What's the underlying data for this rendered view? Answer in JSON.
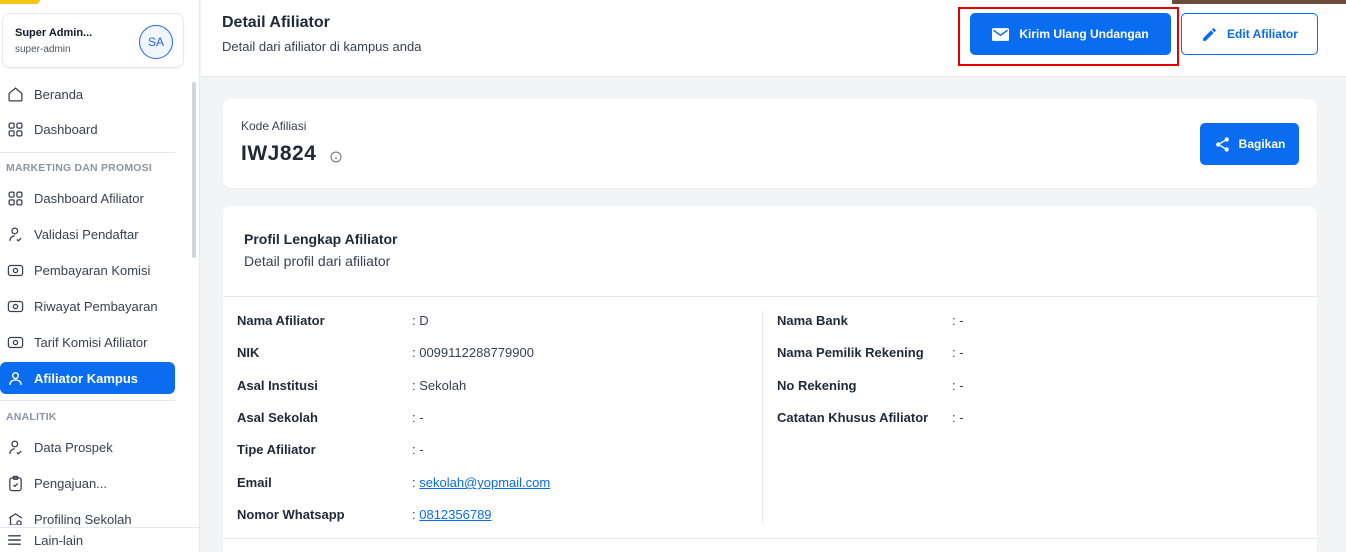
{
  "user": {
    "name": "Super Admin...",
    "role": "super-admin",
    "initials": "SA"
  },
  "sidebar": {
    "items": [
      {
        "label": "Beranda",
        "icon": "home-icon"
      },
      {
        "label": "Dashboard",
        "icon": "grid-icon"
      }
    ],
    "sections": [
      {
        "title": "MARKETING DAN PROMOSI",
        "items": [
          {
            "label": "Dashboard Afiliator",
            "icon": "grid-icon"
          },
          {
            "label": "Validasi Pendaftar",
            "icon": "user-check-icon"
          },
          {
            "label": "Pembayaran Komisi",
            "icon": "money-icon"
          },
          {
            "label": "Riwayat Pembayaran",
            "icon": "money-icon"
          },
          {
            "label": "Tarif Komisi Afiliator",
            "icon": "money-icon"
          },
          {
            "label": "Afiliator Kampus",
            "icon": "user-icon",
            "active": true
          }
        ]
      },
      {
        "title": "ANALITIK",
        "items": [
          {
            "label": "Data Prospek",
            "icon": "user-check-icon"
          },
          {
            "label": "Pengajuan...",
            "icon": "clipboard-check-icon"
          },
          {
            "label": "Profiling Sekolah",
            "icon": "school-search-icon"
          }
        ]
      }
    ],
    "bottom": {
      "label": "Lain-lain",
      "icon": "menu-icon"
    }
  },
  "header": {
    "title": "Detail Afiliator",
    "subtitle": "Detail dari afiliator di kampus anda",
    "resend_label": "Kirim Ulang Undangan",
    "edit_label": "Edit Afiliator"
  },
  "code_card": {
    "label": "Kode Afiliasi",
    "value": "IWJ824",
    "share_label": "Bagikan"
  },
  "profile": {
    "title": "Profil Lengkap Afiliator",
    "subtitle": "Detail profil dari afiliator",
    "left": [
      {
        "label": "Nama Afiliator",
        "value": ": D"
      },
      {
        "label": "NIK",
        "value": ": 0099112288779900"
      },
      {
        "label": "Asal Institusi",
        "value": ": Sekolah"
      },
      {
        "label": "Asal Sekolah",
        "value": ": -"
      },
      {
        "label": "Tipe Afiliator",
        "value": ": -"
      },
      {
        "label": "Email",
        "value": "sekolah@yopmail.com",
        "link": true
      },
      {
        "label": "Nomor Whatsapp",
        "value": "0812356789",
        "link": true
      }
    ],
    "right": [
      {
        "label": "Nama Bank",
        "value": ": -"
      },
      {
        "label": "Nama Pemilik Rekening",
        "value": ": -"
      },
      {
        "label": "No Rekening",
        "value": ": -"
      },
      {
        "label": "Catatan Khusus Afiliator",
        "value": ": -"
      }
    ]
  },
  "colors": {
    "primary": "#0a6cf1",
    "highlight": "#e00000",
    "logo": "#f5c518"
  }
}
